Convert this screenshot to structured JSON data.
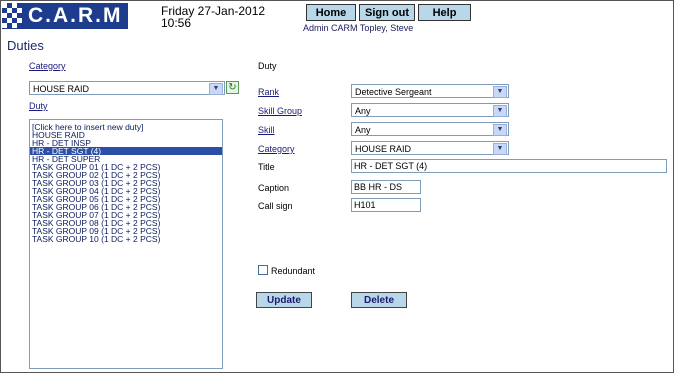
{
  "header": {
    "logo_text": "C.A.R.M",
    "date": "Friday 27-Jan-2012",
    "time": "10:56",
    "nav": [
      "Home",
      "Sign out",
      "Help"
    ],
    "user": "Admin CARM Topley, Steve"
  },
  "page": {
    "title": "Duties"
  },
  "left": {
    "category_label": "Category",
    "category_value": "HOUSE RAID",
    "duty_label": "Duty",
    "duties": [
      "[Click here to insert new duty]",
      "HOUSE RAID",
      "HR - DET INSP",
      "HR - DET SGT (4)",
      "HR - DET SUPER",
      "TASK GROUP 01 (1 DC + 2 PCS)",
      "TASK GROUP 02 (1 DC + 2 PCS)",
      "TASK GROUP 03 (1 DC + 2 PCS)",
      "TASK GROUP 04 (1 DC + 2 PCS)",
      "TASK GROUP 05 (1 DC + 2 PCS)",
      "TASK GROUP 06 (1 DC + 2 PCS)",
      "TASK GROUP 07 (1 DC + 2 PCS)",
      "TASK GROUP 08 (1 DC + 2 PCS)",
      "TASK GROUP 09 (1 DC + 2 PCS)",
      "TASK GROUP 10 (1 DC + 2 PCS)"
    ],
    "selected_index": 3
  },
  "form": {
    "section_title": "Duty",
    "rank_label": "Rank",
    "rank_value": "Detective Sergeant",
    "skill_group_label": "Skill Group",
    "skill_group_value": "Any",
    "skill_label": "Skill",
    "skill_value": "Any",
    "category_label": "Category",
    "category_value": "HOUSE RAID",
    "title_label": "Title",
    "title_value": "HR - DET SGT (4)",
    "caption_label": "Caption",
    "caption_value": "BB HR - DS",
    "callsign_label": "Call sign",
    "callsign_value": "H101",
    "redundant_label": "Redundant",
    "redundant_checked": false,
    "update_label": "Update",
    "delete_label": "Delete"
  },
  "colors": {
    "accent": "#1d3c8e",
    "button": "#b8d8ea",
    "selection": "#2b4fa6"
  }
}
